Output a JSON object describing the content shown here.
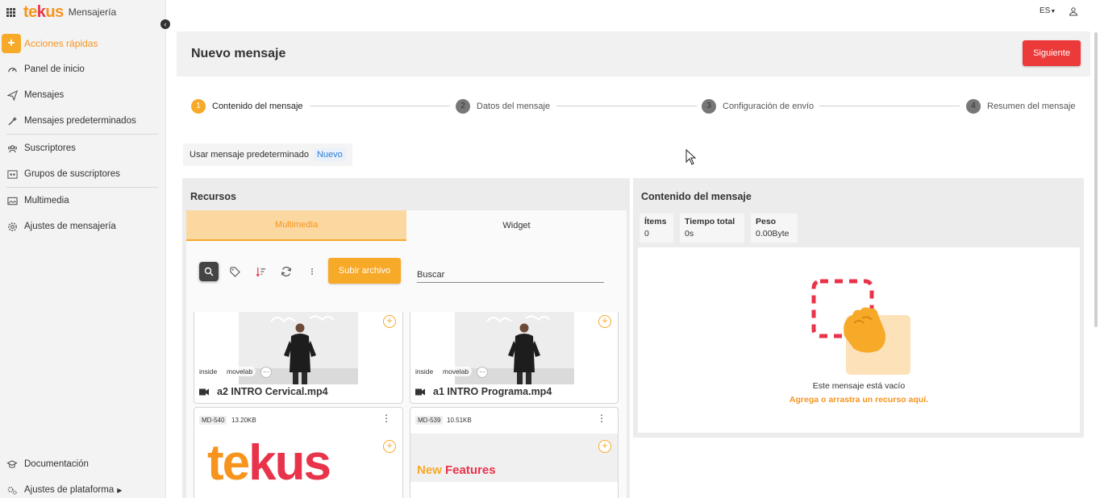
{
  "brand": {
    "logo_part1": "te",
    "logo_part2": "k",
    "logo_part3": "us",
    "app_name": "Mensajería"
  },
  "sidebar": {
    "quick_actions": "Acciones rápidas",
    "items": [
      {
        "label": "Panel de inicio",
        "icon": "gauge-icon"
      },
      {
        "label": "Mensajes",
        "icon": "send-icon"
      },
      {
        "label": "Mensajes predeterminados",
        "icon": "magic-wand-icon"
      },
      {
        "label": "Suscriptores",
        "icon": "people-icon"
      },
      {
        "label": "Grupos de suscriptores",
        "icon": "group-icon"
      },
      {
        "label": "Multimedia",
        "icon": "image-icon"
      },
      {
        "label": "Ajustes de mensajería",
        "icon": "gear-icon"
      }
    ],
    "bottom": [
      {
        "label": "Documentación",
        "icon": "graduation-cap-icon"
      },
      {
        "label": "Ajustes de plataforma",
        "icon": "gears-icon"
      }
    ]
  },
  "topbar": {
    "language": "ES"
  },
  "header": {
    "title": "Nuevo mensaje",
    "next_label": "Siguiente"
  },
  "stepper": [
    {
      "num": "1",
      "label": "Contenido del mensaje"
    },
    {
      "num": "2",
      "label": "Datos del mensaje"
    },
    {
      "num": "3",
      "label": "Configuración de envío"
    },
    {
      "num": "4",
      "label": "Resumen del mensaje"
    }
  ],
  "predefined": {
    "label": "Usar mensaje predeterminado",
    "link": "Nuevo"
  },
  "resources": {
    "title": "Recursos",
    "tabs": [
      "Multimedia",
      "Widget"
    ],
    "upload_label": "Subir archivo",
    "search_placeholder": "Buscar",
    "cards": [
      {
        "name": "a2 INTRO Cervical.mp4",
        "tags": [
          "inside",
          "movelab"
        ]
      },
      {
        "name": "a1 INTRO Programa.mp4",
        "tags": [
          "inside",
          "movelab"
        ]
      },
      {
        "badge": "MD-540",
        "size": "13.20KB",
        "logo_part1": "te",
        "logo_part2": "k",
        "logo_part3": "us"
      },
      {
        "badge": "MD-539",
        "size": "10.51KB",
        "banner_part1": "New",
        "banner_part2": "Features"
      }
    ]
  },
  "message_content": {
    "title": "Contenido del mensaje",
    "stats": [
      {
        "label": "Ítems",
        "value": "0"
      },
      {
        "label": "Tiempo total",
        "value": "0s"
      },
      {
        "label": "Peso",
        "value": "0.00Byte"
      }
    ],
    "empty_text": "Este mensaje está vacío",
    "empty_hint": "Agrega o arrastra un recurso aquí."
  },
  "colors": {
    "accent": "#f7a928",
    "brand_orange": "#f7941d",
    "brand_red": "#e8334a",
    "primary_button": "#ec3a3a"
  }
}
